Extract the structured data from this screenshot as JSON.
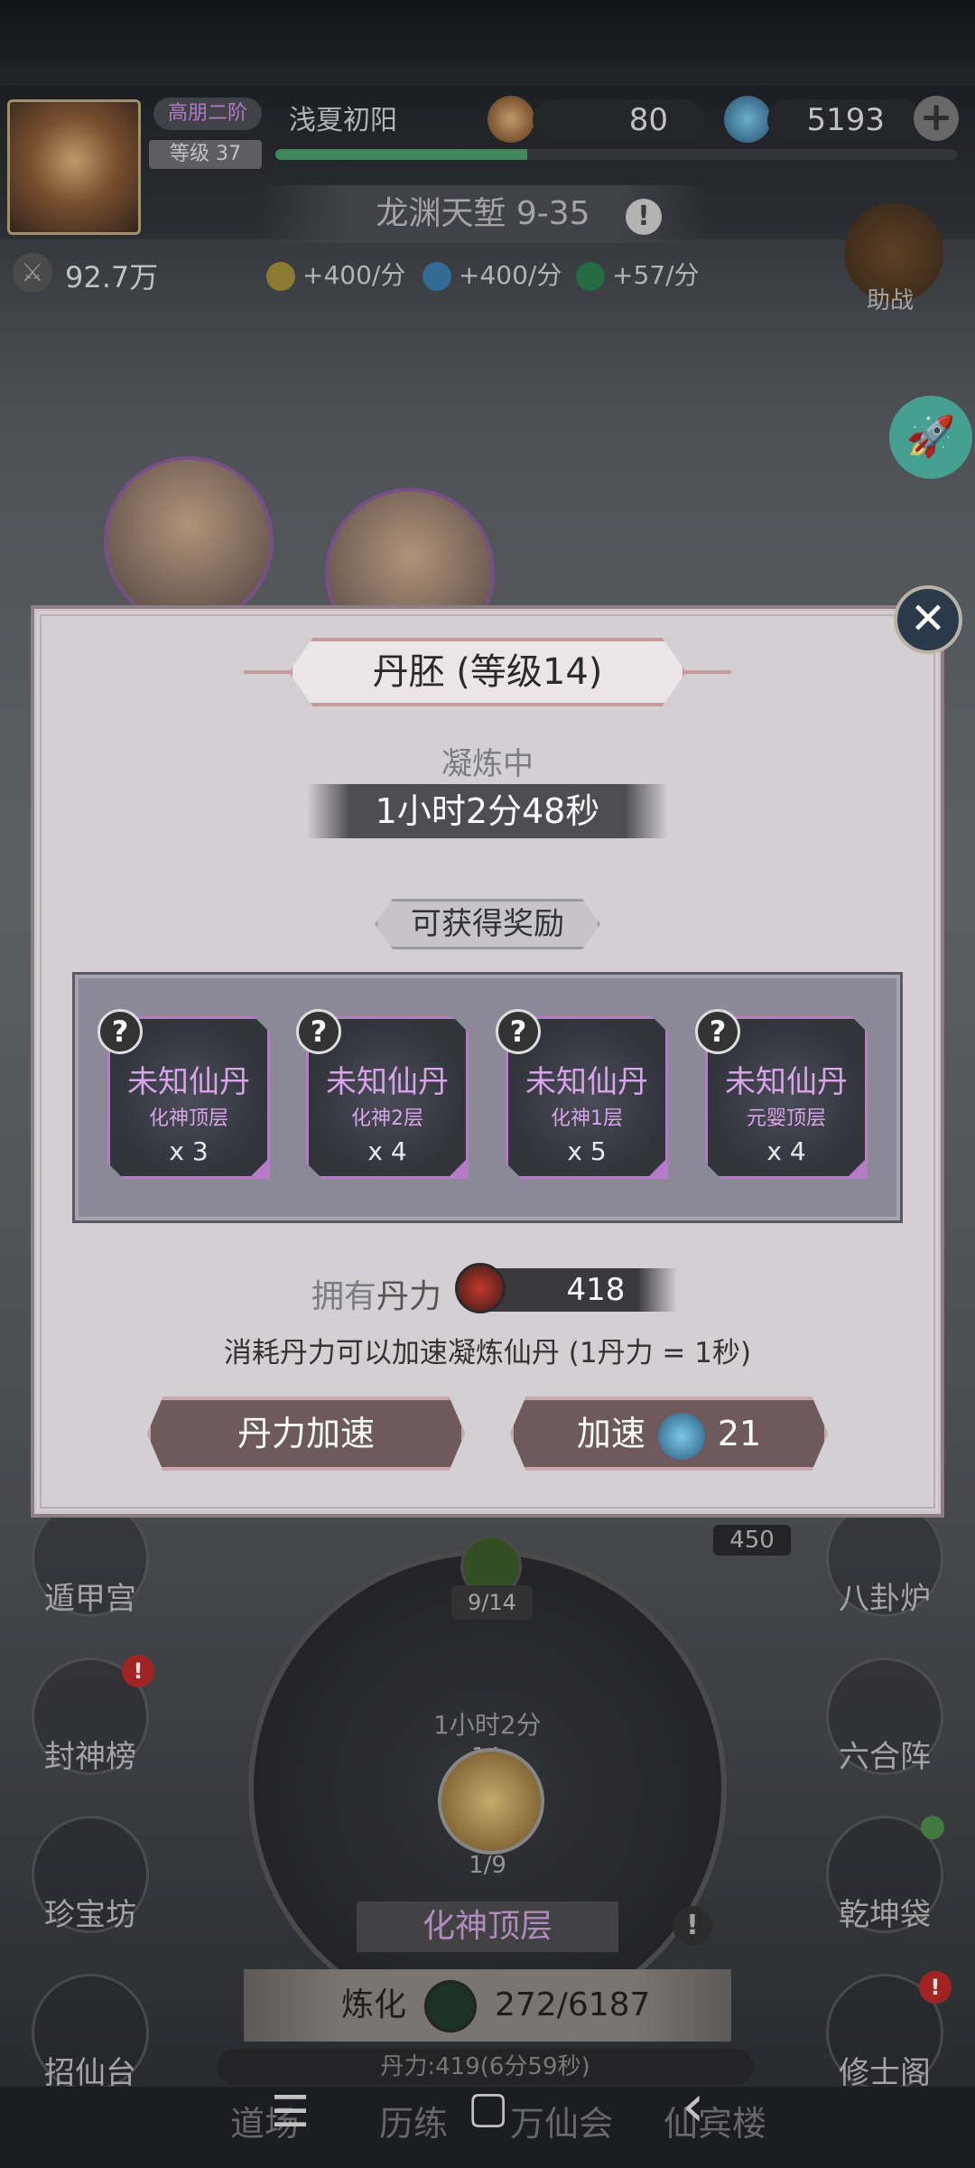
{
  "player": {
    "rank_tag": "高朋二阶",
    "name": "浅夏初阳",
    "level": "等级 37",
    "xp_fraction": 0.37
  },
  "resources": {
    "coins": "80",
    "crystals": "5193",
    "plus": "+"
  },
  "stage": {
    "name": "龙渊天堑 9-35",
    "info": "!"
  },
  "power": "92.7万",
  "rates": [
    "+400/分",
    "+400/分",
    "+57/分"
  ],
  "help_label": "助战",
  "side_menu_left": [
    {
      "label": "遁甲宫",
      "badge": ""
    },
    {
      "label": "封神榜",
      "badge": "!"
    },
    {
      "label": "珍宝坊",
      "badge": ""
    },
    {
      "label": "招仙台",
      "badge": ""
    }
  ],
  "side_menu_right": [
    {
      "label": "八卦炉",
      "badge": ""
    },
    {
      "label": "六合阵",
      "badge": ""
    },
    {
      "label": "乾坤袋",
      "badge": ""
    },
    {
      "label": "修士阁",
      "badge": "!"
    }
  ],
  "furnace": {
    "count": "9/14",
    "time": "1小时2分",
    "level_num": "14",
    "ratio": "1/9",
    "realm": "化神顶层",
    "info": "!",
    "value_450": "450",
    "refine_label": "炼化",
    "refine_progress": "272/6187",
    "dan_strip": "丹力:419(6分59秒)"
  },
  "bottom_tabs": [
    "道场",
    "历练",
    "万仙会",
    "仙宾楼"
  ],
  "nav_keys": {
    "menu": "☰",
    "home": "▢",
    "back": "‹"
  },
  "dialog": {
    "close": "✕",
    "title": "丹胚 (等级14)",
    "status": "凝炼中",
    "timer": "1小时2分48秒",
    "rewards_title": "可获得奖励",
    "rewards": [
      {
        "name": "未知仙丹",
        "sub": "化神顶层",
        "qty": "x 3"
      },
      {
        "name": "未知仙丹",
        "sub": "化神2层",
        "qty": "x 4"
      },
      {
        "name": "未知仙丹",
        "sub": "化神1层",
        "qty": "x 5"
      },
      {
        "name": "未知仙丹",
        "sub": "元婴顶层",
        "qty": "x 4"
      }
    ],
    "own_prefix": "拥有",
    "own_item": "丹力",
    "own_value": "418",
    "hint": "消耗丹力可以加速凝炼仙丹 (1丹力 = 1秒)",
    "btn_dan_speed": "丹力加速",
    "btn_speed": "加速",
    "btn_speed_cost": "21"
  },
  "colors": {
    "accent_purple": "#d9a4ea",
    "dialog_bg": "#d3cfd2",
    "teal_rocket": "#4fb7a7"
  }
}
